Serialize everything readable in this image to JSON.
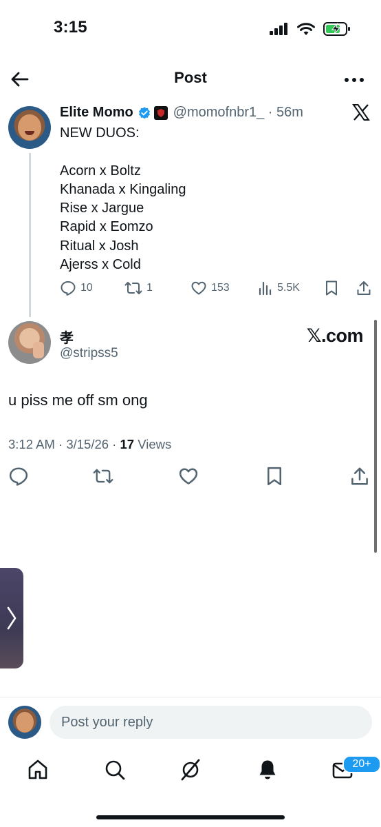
{
  "status_bar": {
    "time": "3:15",
    "icons": [
      "cellular-signal-icon",
      "wifi-icon",
      "battery-charging-icon"
    ]
  },
  "header": {
    "title": "Post",
    "back_icon": "back-arrow-icon",
    "more_icon": "more-options-icon"
  },
  "quoted_post": {
    "author_name": "Elite Momo",
    "handle_time": "@momofnbr1_ · 56m",
    "text": "NEW DUOS:\n\nAcorn x Boltz\nKhanada x Kingaling\nRise x Jargue\nRapid x Eomzo\nRitual x Josh\nAjerss x Cold",
    "stats": {
      "replies": "10",
      "reposts": "1",
      "likes": "153",
      "views": "5.5K"
    }
  },
  "reply_post": {
    "author_name": "孝",
    "handle": "@stripss5",
    "watermark": "𝕏.com",
    "text": "u piss me off sm ong",
    "meta_prefix": "3:12 AM · 3/15/26 · ",
    "views_count": "17",
    "views_label": " Views"
  },
  "composer": {
    "placeholder": "Post your reply"
  },
  "bottom_nav": {
    "items": [
      "home-icon",
      "search-icon",
      "grok-icon",
      "notifications-icon",
      "messages-icon"
    ],
    "messages_badge": "20+"
  },
  "colors": {
    "accent": "#1d9bf0",
    "secondary_text": "#536471",
    "primary_text": "#0f1419"
  }
}
